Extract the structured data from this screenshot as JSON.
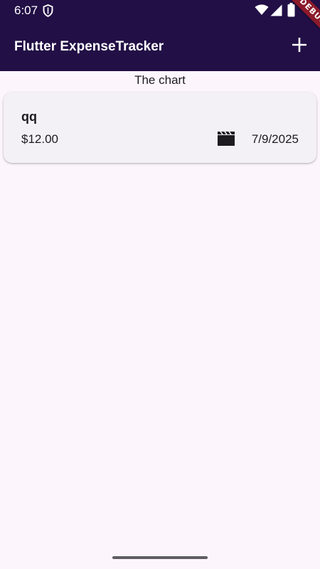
{
  "status_bar": {
    "time": "6:07",
    "icons": [
      "shield-icon",
      "wifi-icon",
      "signal-icon",
      "battery-icon"
    ]
  },
  "debug_banner": {
    "label": "DEBUG"
  },
  "app_bar": {
    "title": "Flutter ExpenseTracker",
    "action_icon": "add-icon",
    "background_color": "#220f46",
    "title_color": "#ffffff"
  },
  "chart": {
    "label": "The chart"
  },
  "expenses": [
    {
      "title": "qq",
      "amount": "$12.00",
      "category_icon": "movie-icon",
      "date": "7/9/2025"
    }
  ],
  "colors": {
    "page_background": "#fcf6fc",
    "card_background": "#f4f1f6",
    "debug_banner": "#8b1a2b"
  }
}
